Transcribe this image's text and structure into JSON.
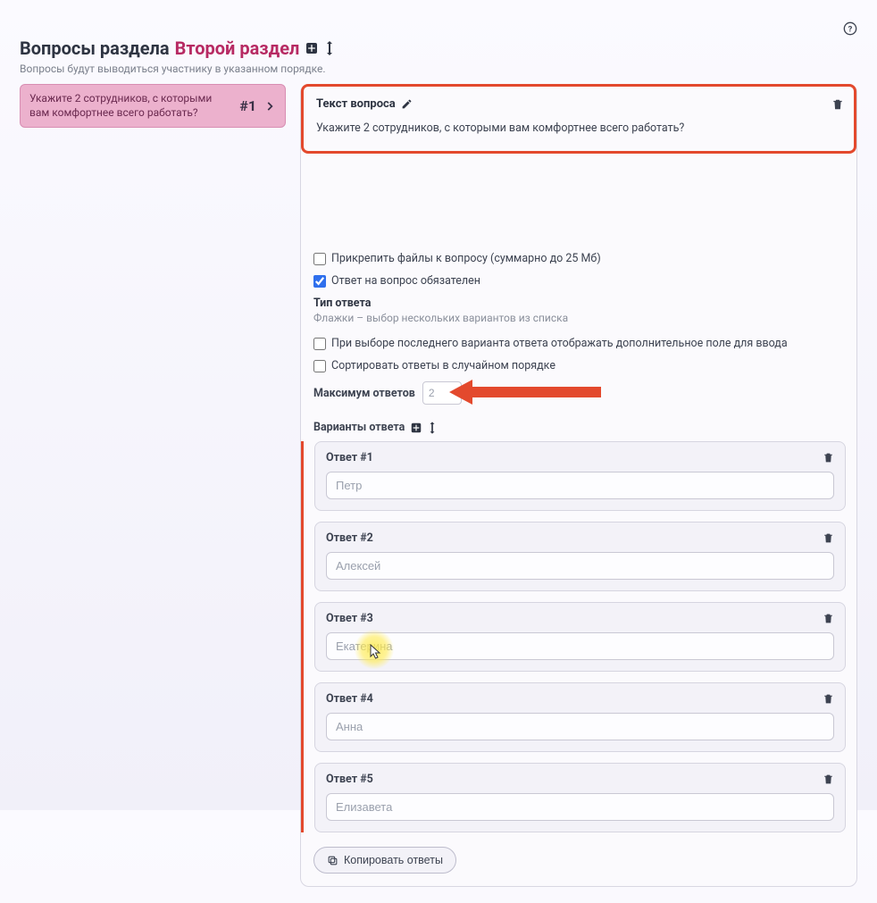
{
  "header": {
    "title_prefix": "Вопросы раздела",
    "section_name": "Второй раздел",
    "subtitle": "Вопросы будут выводиться участнику в указанном порядке."
  },
  "sidebar": {
    "items": [
      {
        "text": "Укажите 2 сотрудников, с которыми вам комфортнее всего работать?",
        "num": "#1"
      }
    ]
  },
  "editor": {
    "qtext_label": "Текст вопроса",
    "qtext_body": "Укажите 2 сотрудников, с которыми вам комфортнее всего работать?",
    "attach_label": "Прикрепить файлы к вопросу (суммарно до 25 Мб)",
    "required_label": "Ответ на вопрос обязателен",
    "type_label": "Тип ответа",
    "type_help": "Флажки – выбор нескольких вариантов из списка",
    "last_option_extra_label": "При выборе последнего варианта ответа отображать дополнительное поле для ввода",
    "shuffle_label": "Сортировать ответы в случайном порядке",
    "max_answers_label": "Максимум ответов",
    "max_answers_value": "2",
    "variants_label": "Варианты ответа"
  },
  "answers": [
    {
      "title": "Ответ #1",
      "value": "Петр"
    },
    {
      "title": "Ответ #2",
      "value": "Алексей"
    },
    {
      "title": "Ответ #3",
      "value": "Екатерина"
    },
    {
      "title": "Ответ #4",
      "value": "Анна"
    },
    {
      "title": "Ответ #5",
      "value": "Елизавета"
    }
  ],
  "copy_btn": "Копировать ответы"
}
